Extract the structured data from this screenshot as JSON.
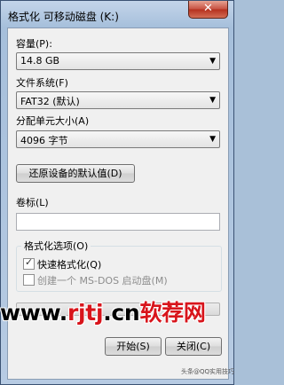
{
  "window": {
    "title": "格式化 可移动磁盘 (K:)",
    "close_icon": "✕"
  },
  "capacity": {
    "label": "容量(P):",
    "value": "14.8 GB"
  },
  "filesystem": {
    "label": "文件系统(F)",
    "value": "FAT32 (默认)"
  },
  "allocation": {
    "label": "分配单元大小(A)",
    "value": "4096 字节"
  },
  "restore_button": "还原设备的默认值(D)",
  "volume": {
    "label": "卷标(L)",
    "value": ""
  },
  "format_options": {
    "title": "格式化选项(O)",
    "quick_format": {
      "label": "快速格式化(Q)",
      "checked": true
    },
    "msdos_disk": {
      "label": "创建一个 MS-DOS 启动盘(M)",
      "checked": false,
      "enabled": false
    }
  },
  "progress": {
    "value": 0
  },
  "buttons": {
    "start": "开始(S)",
    "close": "关闭(C)"
  },
  "watermark": {
    "prefix": "www.",
    "brand": "rjtj",
    "suffix": ".cn",
    "cn": "软荐网",
    "small": "头条@QQ实用技巧"
  }
}
